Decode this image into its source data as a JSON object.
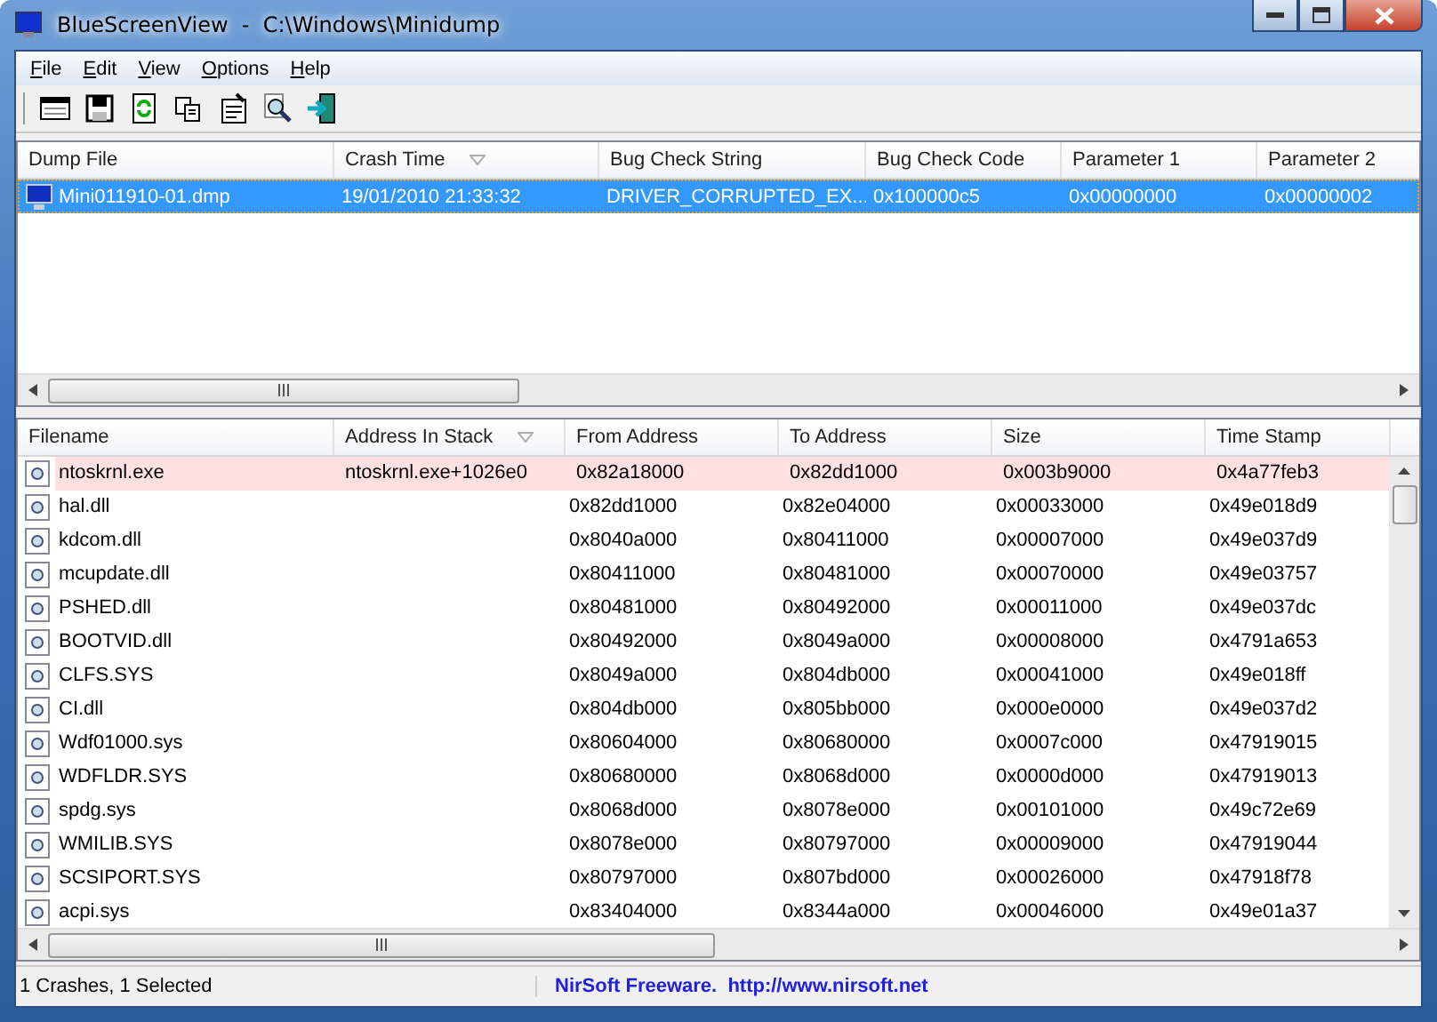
{
  "window": {
    "title": "BlueScreenView  -  C:\\Windows\\Minidump"
  },
  "menu": [
    "File",
    "Edit",
    "View",
    "Options",
    "Help"
  ],
  "crash_list": {
    "columns": [
      {
        "label": "Dump File",
        "sorted": false
      },
      {
        "label": "Crash Time",
        "sorted": true
      },
      {
        "label": "Bug Check String",
        "sorted": false
      },
      {
        "label": "Bug Check Code",
        "sorted": false
      },
      {
        "label": "Parameter 1",
        "sorted": false
      },
      {
        "label": "Parameter 2",
        "sorted": false
      }
    ],
    "rows": [
      {
        "selected": true,
        "cells": [
          "Mini011910-01.dmp",
          "19/01/2010 21:33:32",
          "DRIVER_CORRUPTED_EX...",
          "0x100000c5",
          "0x00000000",
          "0x00000002"
        ]
      }
    ]
  },
  "driver_list": {
    "columns": [
      {
        "label": "Filename",
        "sorted": false
      },
      {
        "label": "Address In Stack",
        "sorted": true
      },
      {
        "label": "From Address",
        "sorted": false
      },
      {
        "label": "To Address",
        "sorted": false
      },
      {
        "label": "Size",
        "sorted": false
      },
      {
        "label": "Time Stamp",
        "sorted": false
      }
    ],
    "rows": [
      {
        "highlighted": true,
        "cells": [
          "ntoskrnl.exe",
          "ntoskrnl.exe+1026e0",
          "0x82a18000",
          "0x82dd1000",
          "0x003b9000",
          "0x4a77feb3"
        ]
      },
      {
        "highlighted": false,
        "cells": [
          "hal.dll",
          "",
          "0x82dd1000",
          "0x82e04000",
          "0x00033000",
          "0x49e018d9"
        ]
      },
      {
        "highlighted": false,
        "cells": [
          "kdcom.dll",
          "",
          "0x8040a000",
          "0x80411000",
          "0x00007000",
          "0x49e037d9"
        ]
      },
      {
        "highlighted": false,
        "cells": [
          "mcupdate.dll",
          "",
          "0x80411000",
          "0x80481000",
          "0x00070000",
          "0x49e03757"
        ]
      },
      {
        "highlighted": false,
        "cells": [
          "PSHED.dll",
          "",
          "0x80481000",
          "0x80492000",
          "0x00011000",
          "0x49e037dc"
        ]
      },
      {
        "highlighted": false,
        "cells": [
          "BOOTVID.dll",
          "",
          "0x80492000",
          "0x8049a000",
          "0x00008000",
          "0x4791a653"
        ]
      },
      {
        "highlighted": false,
        "cells": [
          "CLFS.SYS",
          "",
          "0x8049a000",
          "0x804db000",
          "0x00041000",
          "0x49e018ff"
        ]
      },
      {
        "highlighted": false,
        "cells": [
          "CI.dll",
          "",
          "0x804db000",
          "0x805bb000",
          "0x000e0000",
          "0x49e037d2"
        ]
      },
      {
        "highlighted": false,
        "cells": [
          "Wdf01000.sys",
          "",
          "0x80604000",
          "0x80680000",
          "0x0007c000",
          "0x47919015"
        ]
      },
      {
        "highlighted": false,
        "cells": [
          "WDFLDR.SYS",
          "",
          "0x80680000",
          "0x8068d000",
          "0x0000d000",
          "0x47919013"
        ]
      },
      {
        "highlighted": false,
        "cells": [
          "spdg.sys",
          "",
          "0x8068d000",
          "0x8078e000",
          "0x00101000",
          "0x49c72e69"
        ]
      },
      {
        "highlighted": false,
        "cells": [
          "WMILIB.SYS",
          "",
          "0x8078e000",
          "0x80797000",
          "0x00009000",
          "0x47919044"
        ]
      },
      {
        "highlighted": false,
        "cells": [
          "SCSIPORT.SYS",
          "",
          "0x80797000",
          "0x807bd000",
          "0x00026000",
          "0x47918f78"
        ]
      },
      {
        "highlighted": false,
        "cells": [
          "acpi.sys",
          "",
          "0x83404000",
          "0x8344a000",
          "0x00046000",
          "0x49e01a37"
        ]
      }
    ]
  },
  "status_bar": {
    "summary": "1 Crashes, 1 Selected",
    "credit": "NirSoft Freeware.  http://www.nirsoft.net"
  }
}
